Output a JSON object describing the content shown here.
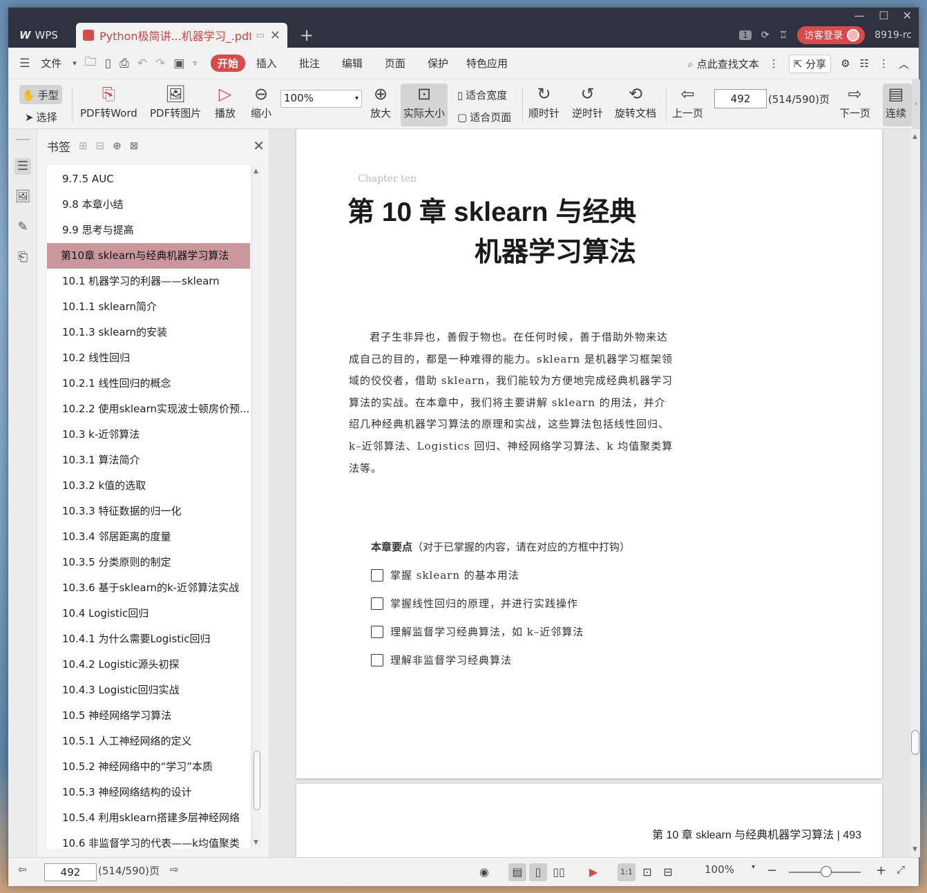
{
  "titlebar": {
    "app_tab": "WPS",
    "doc_tab": "Python极简讲...机器学习_.pdf",
    "badge": "1",
    "login": "访客登录",
    "user": "8919-rc"
  },
  "menubar": {
    "file": "文件",
    "tabs": [
      "开始",
      "插入",
      "批注",
      "编辑",
      "页面",
      "保护",
      "特色应用"
    ],
    "search": "点此查找文本",
    "share": "分享"
  },
  "toolbar": {
    "hand": "手型",
    "select": "选择",
    "pdf2word": "PDF转Word",
    "pdf2img": "PDF转图片",
    "play": "播放",
    "zoom_out": "缩小",
    "zoom_value": "100%",
    "zoom_in": "放大",
    "actual": "实际大小",
    "fit_width": "适合宽度",
    "fit_page": "适合页面",
    "cw": "顺时针",
    "ccw": "逆时针",
    "rotate": "旋转文档",
    "prev": "上一页",
    "page": "492",
    "page_info": "(514/590)页",
    "next": "下一页",
    "continuous": "连续"
  },
  "panel": {
    "title": "书签",
    "items": [
      "9.7.5  AUC",
      "9.8  本章小结",
      "9.9  思考与提高",
      "第10章  sklearn与经典机器学习算法",
      "10.1  机器学习的利器——sklearn",
      "10.1.1  sklearn简介",
      "10.1.3  sklearn的安装",
      "10.2  线性回归",
      "10.2.1  线性回归的概念",
      "10.2.2  使用sklearn实现波士顿房价预...",
      "10.3  k-近邻算法",
      "10.3.1  算法简介",
      "10.3.2  k值的选取",
      "10.3.3  特征数据的归一化",
      "10.3.4  邻居距离的度量",
      "10.3.5  分类原则的制定",
      "10.3.6  基于sklearn的k-近邻算法实战",
      "10.4  Logistic回归",
      "10.4.1  为什么需要Logistic回归",
      "10.4.2  Logistic源头初探",
      "10.4.3  Logistic回归实战",
      "10.5  神经网络学习算法",
      "10.5.1  人工神经网络的定义",
      "10.5.2  神经网络中的“学习”本质",
      "10.5.3  神经网络结构的设计",
      "10.5.4  利用sklearn搭建多层神经网络",
      "10.6  非监督学习的代表——k均值聚类"
    ]
  },
  "document": {
    "chapter_en": "Chapter ten",
    "title_line1": "第 10 章    sklearn 与经典",
    "title_line2": "机器学习算法",
    "intro": "君子生非异也，善假于物也。在任何时候，善于借助外物来达成自己的目的，都是一种难得的能力。sklearn 是机器学习框架领域的佼佼者，借助 sklearn，我们能较为方便地完成经典机器学习算法的实战。在本章中，我们将主要讲解 sklearn 的用法，并介绍几种经典机器学习算法的原理和实战，这些算法包括线性回归、k–近邻算法、Logistics 回归、神经网络学习算法、k 均值聚类算法等。",
    "key_head": "本章要点",
    "key_note": "（对于已掌握的内容，请在对应的方框中打钩）",
    "key_points": [
      "掌握 sklearn 的基本用法",
      "掌握线性回归的原理，并进行实践操作",
      "理解监督学习经典算法，如 k–近邻算法",
      "理解非监督学习经典算法"
    ],
    "next_header": "第 10 章    sklearn 与经典机器学习算法    |    493"
  },
  "statusbar": {
    "page": "492",
    "page_info": "(514/590)页",
    "zoom": "100%"
  }
}
